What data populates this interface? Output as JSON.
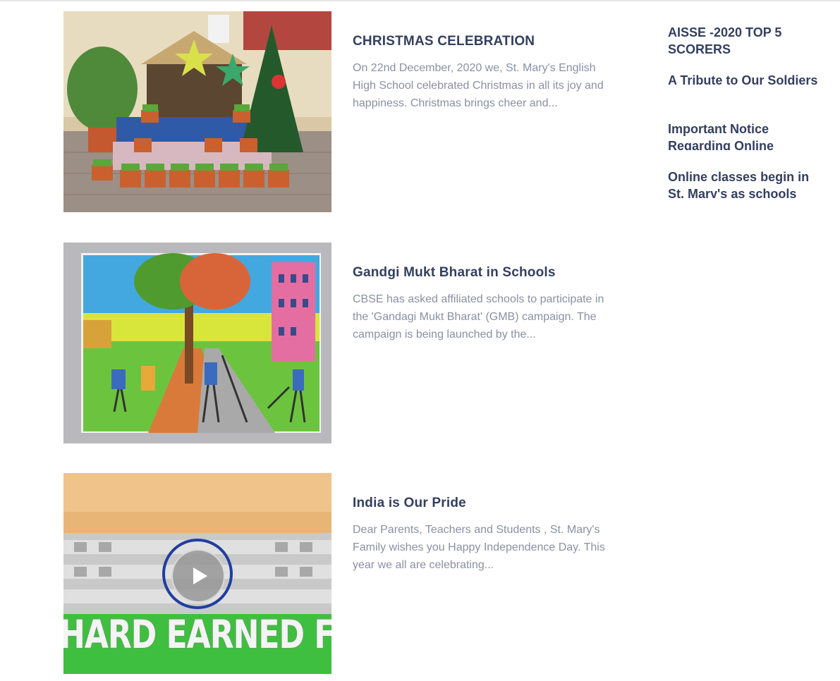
{
  "posts": [
    {
      "title": "CHRISTMAS CELEBRATION",
      "excerpt": "On 22nd December, 2020 we, St. Mary's English High School celebrated Christmas in all its joy and happiness. Christmas brings cheer and...",
      "image": "christmas-crib-photo"
    },
    {
      "title": "Gandgi Mukt Bharat in Schools",
      "excerpt": "CBSE has asked affiliated schools to participate in the 'Gandagi Mukt Bharat' (GMB) campaign. The campaign is being launched by the...",
      "image": "cleanliness-drawing"
    },
    {
      "title": "India is Our Pride",
      "excerpt": "Dear Parents, Teachers and Students , St. Mary's Family wishes you Happy Independence Day. This year we all are celebrating...",
      "image": "independence-day-video",
      "video_caption": "HARD EARNED FREEDOM",
      "play_icon": "play-icon"
    }
  ],
  "sidebar": {
    "items": [
      {
        "label": "AISSE -2020 TOP 5 SCORERS"
      },
      {
        "label": "A Tribute to Our Soldiers"
      },
      {
        "label": "Important Notice Regarding Online Classes"
      },
      {
        "label": "Online classes begin in St. Mary's as schools remain closed"
      }
    ]
  },
  "colors": {
    "title": "#333f5f",
    "excerpt": "#8a90a3",
    "background": "#ffffff"
  }
}
